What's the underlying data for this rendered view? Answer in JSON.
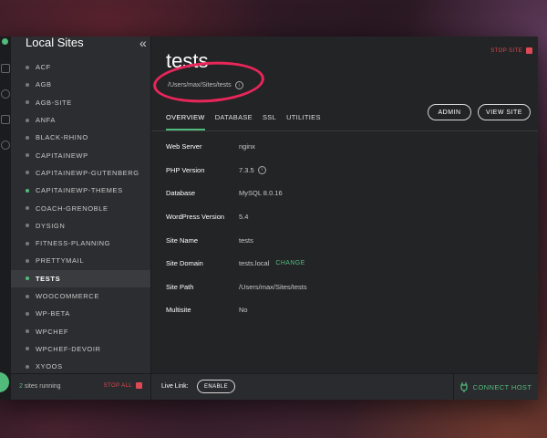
{
  "sidebar": {
    "title": "Local Sites",
    "collapse_icon": "«",
    "sites": [
      {
        "label": "ACF",
        "running": false,
        "active": false
      },
      {
        "label": "AGB",
        "running": false,
        "active": false
      },
      {
        "label": "AGB-SITE",
        "running": false,
        "active": false
      },
      {
        "label": "ANFA",
        "running": false,
        "active": false
      },
      {
        "label": "BLACK-RHINO",
        "running": false,
        "active": false
      },
      {
        "label": "CAPITAINEWP",
        "running": false,
        "active": false
      },
      {
        "label": "CAPITAINEWP-GUTENBERG",
        "running": false,
        "active": false
      },
      {
        "label": "CAPITAINEWP-THEMES",
        "running": true,
        "active": false
      },
      {
        "label": "COACH-GRENOBLE",
        "running": false,
        "active": false
      },
      {
        "label": "DYSIGN",
        "running": false,
        "active": false
      },
      {
        "label": "FITNESS-PLANNING",
        "running": false,
        "active": false
      },
      {
        "label": "PRETTYMAIL",
        "running": false,
        "active": false
      },
      {
        "label": "TESTS",
        "running": true,
        "active": true
      },
      {
        "label": "WOOCOMMERCE",
        "running": false,
        "active": false
      },
      {
        "label": "WP-BETA",
        "running": false,
        "active": false
      },
      {
        "label": "WPCHEF",
        "running": false,
        "active": false
      },
      {
        "label": "WPCHEF-DEVOIR",
        "running": false,
        "active": false
      },
      {
        "label": "XYOOS",
        "running": false,
        "active": false
      }
    ],
    "running_count": "2",
    "running_suffix": " sites running",
    "stop_all": "STOP ALL"
  },
  "site": {
    "title": "tests",
    "path": "/Users/max/Sites/tests",
    "stop_site": "STOP SITE",
    "tabs": [
      "OVERVIEW",
      "DATABASE",
      "SSL",
      "UTILITIES"
    ],
    "admin_button": "ADMIN",
    "view_site_button": "VIEW SITE",
    "details": [
      {
        "key": "Web Server",
        "value": "nginx"
      },
      {
        "key": "PHP Version",
        "value": "7.3.5"
      },
      {
        "key": "Database",
        "value": "MySQL 8.0.16"
      },
      {
        "key": "WordPress Version",
        "value": "5.4"
      },
      {
        "key": "Site Name",
        "value": "tests"
      },
      {
        "key": "Site Domain",
        "value": "tests.local"
      },
      {
        "key": "Site Path",
        "value": "/Users/max/Sites/tests"
      },
      {
        "key": "Multisite",
        "value": "No"
      }
    ],
    "change_label": "CHANGE"
  },
  "footer": {
    "live_link_label": "Live Link:",
    "enable_button": "ENABLE",
    "connect_host": "CONNECT HOST"
  },
  "colors": {
    "accent_green": "#51bb7b",
    "stop_red": "#e04856",
    "annotation_red": "#e8265a"
  }
}
